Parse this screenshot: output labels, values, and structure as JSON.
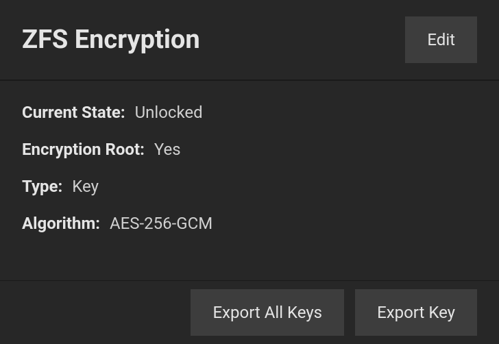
{
  "header": {
    "title": "ZFS Encryption",
    "editButton": "Edit"
  },
  "details": {
    "currentState": {
      "label": "Current State:",
      "value": "Unlocked"
    },
    "encryptionRoot": {
      "label": "Encryption Root:",
      "value": "Yes"
    },
    "type": {
      "label": "Type:",
      "value": "Key"
    },
    "algorithm": {
      "label": "Algorithm:",
      "value": "AES-256-GCM"
    }
  },
  "footer": {
    "exportAllKeysButton": "Export All Keys",
    "exportKeyButton": "Export Key"
  }
}
